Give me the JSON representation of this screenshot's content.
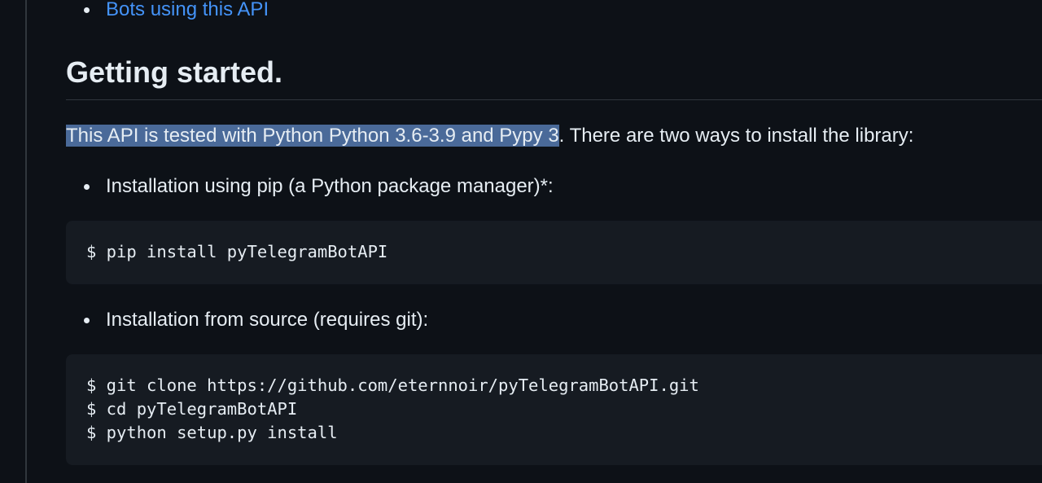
{
  "bullets_top": [
    {
      "label": "Bots using this API"
    }
  ],
  "section": {
    "heading": "Getting started."
  },
  "intro": {
    "selected_text": "This API is tested with Python Python 3.6-3.9 and Pypy 3",
    "rest_text": ". There are two ways to install the library:"
  },
  "install_methods": [
    {
      "label": "Installation using pip (a Python package manager)*:"
    },
    {
      "label": "Installation from source (requires git):"
    }
  ],
  "code_blocks": [
    {
      "lines": [
        "$ pip install pyTelegramBotAPI"
      ]
    },
    {
      "lines": [
        "$ git clone https://github.com/eternnoir/pyTelegramBotAPI.git",
        "$ cd pyTelegramBotAPI",
        "$ python setup.py install"
      ]
    }
  ],
  "colors": {
    "background": "#0d1117",
    "text": "#e6edf3",
    "link": "#4493f8",
    "code_background": "#161b22",
    "selection": "#4a6a99",
    "rule": "#30363d"
  }
}
